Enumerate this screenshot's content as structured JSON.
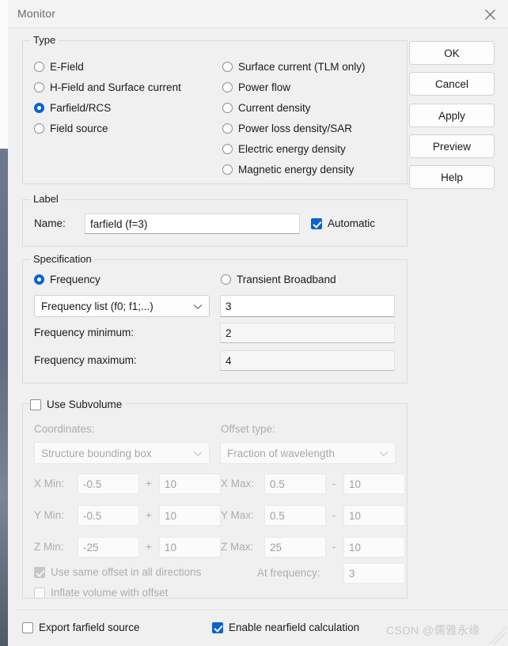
{
  "window": {
    "title": "Monitor",
    "close_icon": "close-icon"
  },
  "type_group": {
    "legend": "Type",
    "options_left": [
      {
        "label": "E-Field",
        "selected": false
      },
      {
        "label": "H-Field and Surface current",
        "selected": false
      },
      {
        "label": "Farfield/RCS",
        "selected": true
      },
      {
        "label": "Field source",
        "selected": false
      }
    ],
    "options_right": [
      {
        "label": "Surface current (TLM only)",
        "selected": false
      },
      {
        "label": "Power flow",
        "selected": false
      },
      {
        "label": "Current density",
        "selected": false
      },
      {
        "label": "Power loss density/SAR",
        "selected": false
      },
      {
        "label": "Electric energy density",
        "selected": false
      },
      {
        "label": "Magnetic energy density",
        "selected": false
      }
    ]
  },
  "buttons": {
    "ok": "OK",
    "cancel": "Cancel",
    "apply": "Apply",
    "preview": "Preview",
    "help": "Help"
  },
  "label_group": {
    "legend": "Label",
    "name_label": "Name:",
    "name_value": "farfield (f=3)",
    "name_placeholder": "",
    "automatic_label": "Automatic",
    "automatic_checked": true
  },
  "specification": {
    "legend": "Specification",
    "frequency_radio": "Frequency",
    "frequency_selected": true,
    "transient_radio": "Transient Broadband",
    "transient_selected": false,
    "frequency_mode": "Frequency list (f0; f1;...)",
    "frequency_list_value": "3",
    "freq_min_label": "Frequency minimum:",
    "freq_min_value": "2",
    "freq_max_label": "Frequency maximum:",
    "freq_max_value": "4"
  },
  "subvolume": {
    "legend": "Use Subvolume",
    "enabled": false,
    "coordinates_label": "Coordinates:",
    "coordinates_value": "Structure bounding box",
    "offset_type_label": "Offset type:",
    "offset_type_value": "Fraction of wavelength",
    "rows": [
      {
        "min_label": "X Min:",
        "min_value": "-0.5",
        "min_op": "+",
        "min_offset": "10",
        "max_label": "X Max:",
        "max_value": "0.5",
        "max_op": "-",
        "max_offset": "10"
      },
      {
        "min_label": "Y Min:",
        "min_value": "-0.5",
        "min_op": "+",
        "min_offset": "10",
        "max_label": "Y Max:",
        "max_value": "0.5",
        "max_op": "-",
        "max_offset": "10"
      },
      {
        "min_label": "Z Min:",
        "min_value": "-25",
        "min_op": "+",
        "min_offset": "10",
        "max_label": "Z Max:",
        "max_value": "25",
        "max_op": "-",
        "max_offset": "10"
      }
    ],
    "same_offset_label": "Use same offset in all directions",
    "same_offset_checked": true,
    "at_frequency_label": "At frequency:",
    "at_frequency_value": "3",
    "inflate_label": "Inflate volume with offset",
    "inflate_checked": false
  },
  "footer": {
    "export_label": "Export farfield source",
    "export_checked": false,
    "nearfield_label": "Enable nearfield calculation",
    "nearfield_checked": true
  },
  "watermark": {
    "text": "CSDN @儒雅永缘"
  },
  "colors": {
    "accent": "#0b63ce",
    "dialog_bg": "#f0f0f0",
    "border": "#dcdcdc",
    "disabled_text": "#a9aeb4"
  }
}
